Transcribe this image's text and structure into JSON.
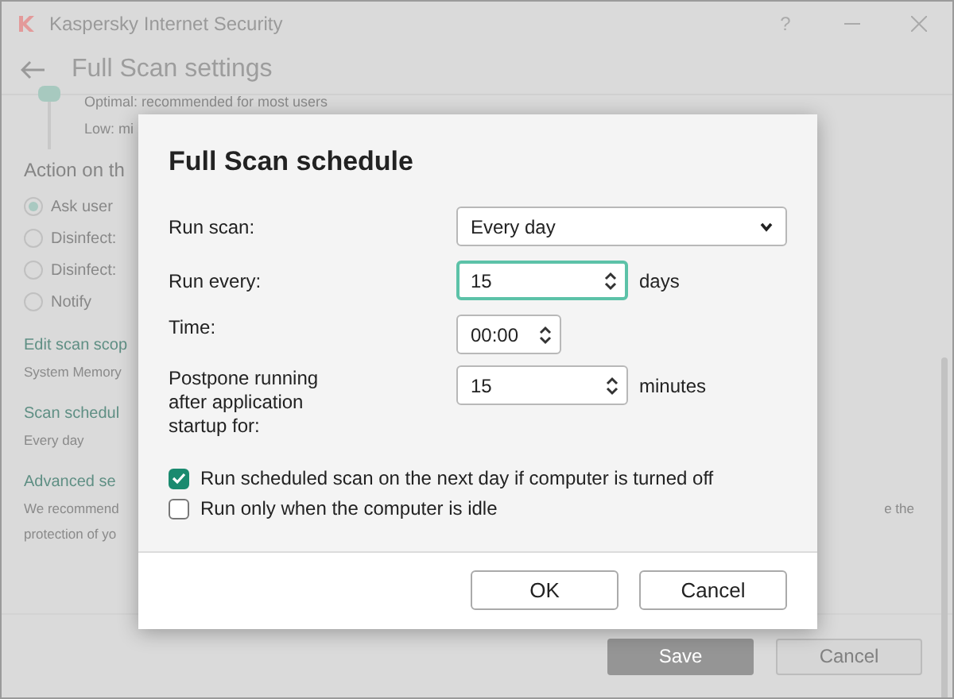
{
  "window": {
    "title": "Kaspersky Internet Security",
    "help": "?"
  },
  "background": {
    "page_title": "Full Scan settings",
    "level_options": [
      "Optimal: recommended for most users",
      "Low: mi"
    ],
    "action_heading": "Action on th",
    "actions": [
      {
        "label": "Ask user",
        "selected": true
      },
      {
        "label": "Disinfect:",
        "selected": false
      },
      {
        "label": "Disinfect:",
        "selected": false
      },
      {
        "label": "Notify",
        "selected": false
      }
    ],
    "sections": [
      {
        "heading": "Edit scan scop",
        "lines": [
          "System Memory"
        ]
      },
      {
        "heading": "Scan schedul",
        "lines": [
          "Every day"
        ]
      },
      {
        "heading": "Advanced se",
        "lines": [
          "We recommend",
          "protection of yo"
        ]
      }
    ],
    "right_fragment": "e the",
    "buttons": [
      {
        "label": "Save",
        "kind": "primary"
      },
      {
        "label": "Cancel",
        "kind": "secondary"
      }
    ]
  },
  "dialog": {
    "title": "Full Scan schedule",
    "fields": [
      {
        "kind": "select",
        "label": "Run scan:",
        "value": "Every day"
      },
      {
        "kind": "spin",
        "label": "Run every:",
        "value": "15",
        "unit": "days",
        "focused": true
      },
      {
        "kind": "time",
        "label": "Time:",
        "value": "00:00"
      },
      {
        "kind": "spin",
        "label": "Postpone running after application startup for:",
        "value": "15",
        "unit": "minutes",
        "focused": false
      }
    ],
    "options": [
      {
        "label": "Run scheduled scan on the next day if computer is turned off",
        "checked": true
      },
      {
        "label": "Run only when the computer is idle",
        "checked": false
      }
    ],
    "buttons": [
      "OK",
      "Cancel"
    ]
  }
}
